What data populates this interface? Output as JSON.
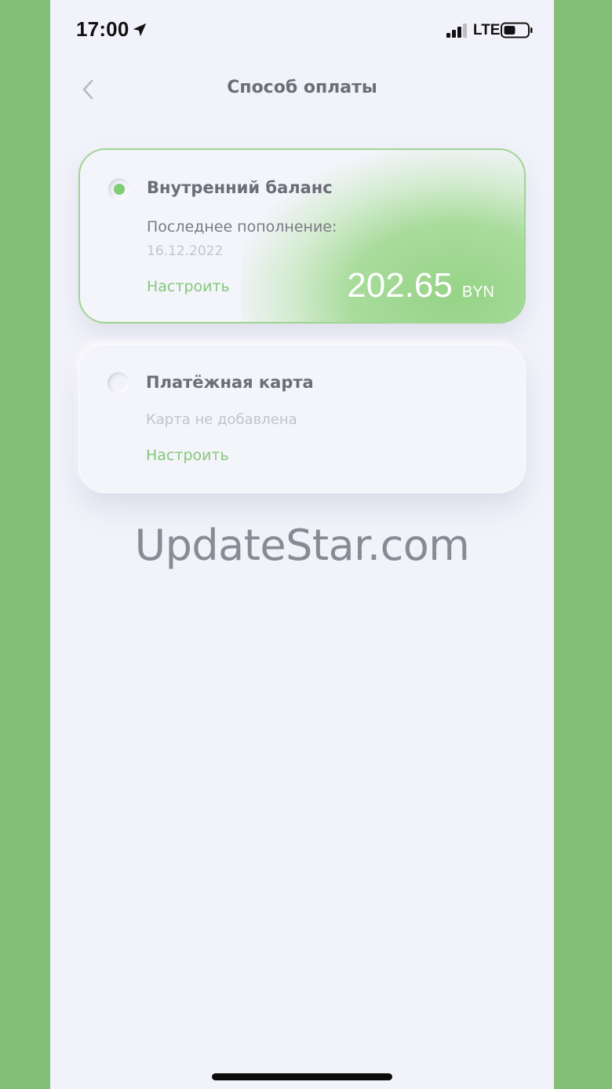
{
  "status_bar": {
    "time": "17:00",
    "network": "LTE",
    "icons": [
      "location-arrow-icon",
      "signal-icon",
      "battery-icon"
    ]
  },
  "nav": {
    "back_icon": "chevron-left-icon",
    "title": "Способ оплаты"
  },
  "payment_methods": [
    {
      "title": "Внутренний баланс",
      "selected": true,
      "last_topup_label": "Последнее пополнение:",
      "last_topup_date": "16.12.2022",
      "setup_label": "Настроить",
      "amount": "202.65",
      "currency": "BYN"
    },
    {
      "title": "Платёжная карта",
      "selected": false,
      "status": "Карта не добавлена",
      "setup_label": "Настроить"
    }
  ],
  "watermark": "UpdateStar.com",
  "colors": {
    "accent_green": "#86c87b",
    "background": "#f2f2fa",
    "outer_background": "#83bf76",
    "text_primary": "#6d6d78"
  }
}
